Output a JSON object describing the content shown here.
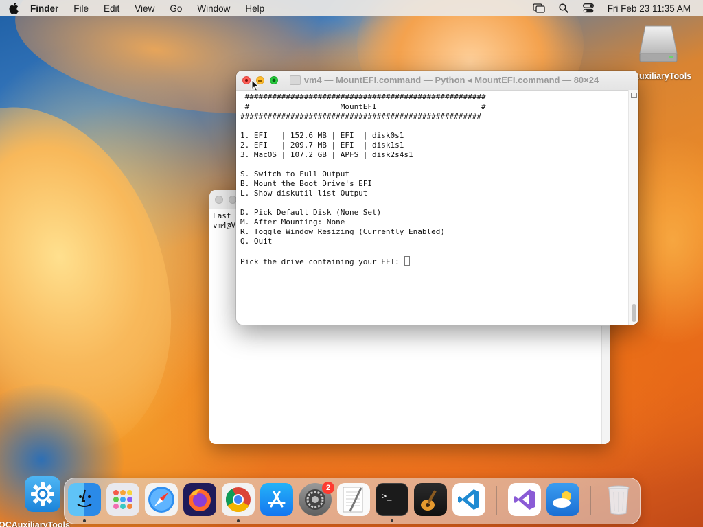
{
  "menubar": {
    "app_name": "Finder",
    "items": [
      "File",
      "Edit",
      "View",
      "Go",
      "Window",
      "Help"
    ],
    "clock": "Fri Feb 23  11:35 AM"
  },
  "desktop": {
    "drive_label": "AuxiliaryTools",
    "oc_label": "OCAuxiliaryTools"
  },
  "back_window": {
    "lines": [
      "Last",
      "vm4@V"
    ]
  },
  "front_window": {
    "title": "vm4 — MountEFI.command — Python ◂ MountEFI.command — 80×24",
    "lines": [
      " #####################################################",
      " #                    MountEFI                       #",
      "#####################################################",
      "",
      "1. EFI   | 152.6 MB | EFI  | disk0s1",
      "2. EFI   | 209.7 MB | EFI  | disk1s1",
      "3. MacOS | 107.2 GB | APFS | disk2s4s1",
      "",
      "S. Switch to Full Output",
      "B. Mount the Boot Drive's EFI",
      "L. Show diskutil list Output",
      "",
      "D. Pick Default Disk (None Set)",
      "M. After Mounting: None",
      "R. Toggle Window Resizing (Currently Enabled)",
      "Q. Quit",
      ""
    ],
    "prompt": "Pick the drive containing your EFI: "
  },
  "dock": {
    "settings_badge": "2",
    "apps": [
      "finder-icon",
      "launchpad-icon",
      "safari-icon",
      "firefox-icon",
      "chrome-icon",
      "app-store-icon",
      "system-settings-icon",
      "textedit-icon",
      "terminal-icon",
      "garageband-icon",
      "vscode-icon",
      "visual-studio-icon",
      "weather-icon",
      "trash-icon"
    ]
  }
}
